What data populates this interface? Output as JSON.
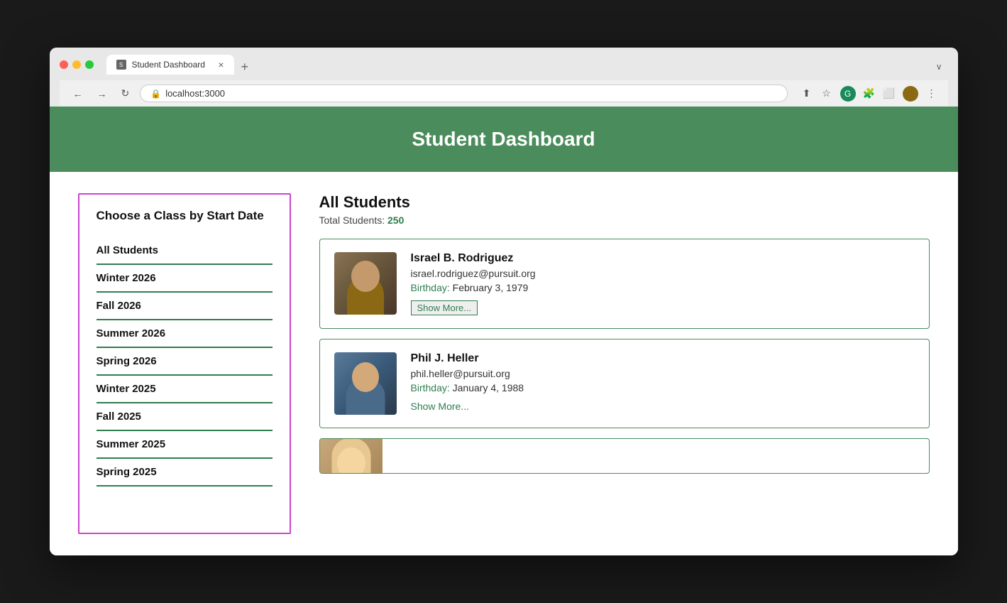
{
  "browser": {
    "tab_title": "Student Dashboard",
    "tab_close": "×",
    "tab_new": "+",
    "tab_dropdown": "∨",
    "url": "localhost:3000",
    "nav": {
      "back": "←",
      "forward": "→",
      "reload": "↻",
      "share": "⬆",
      "star": "☆",
      "menu": "⋮"
    }
  },
  "header": {
    "title": "Student Dashboard"
  },
  "sidebar": {
    "title": "Choose a Class by Start Date",
    "items": [
      {
        "label": "All Students"
      },
      {
        "label": "Winter 2026"
      },
      {
        "label": "Fall 2026"
      },
      {
        "label": "Summer 2026"
      },
      {
        "label": "Spring 2026"
      },
      {
        "label": "Winter 2025"
      },
      {
        "label": "Fall 2025"
      },
      {
        "label": "Summer 2025"
      },
      {
        "label": "Spring 2025"
      }
    ]
  },
  "main": {
    "section_title": "All Students",
    "total_label": "Total Students:",
    "total_count": "250",
    "students": [
      {
        "name": "Israel B. Rodriguez",
        "email": "israel.rodriguez@pursuit.org",
        "birthday_label": "Birthday:",
        "birthday": "February 3, 1979",
        "show_more": "Show More...",
        "avatar_type": "israel"
      },
      {
        "name": "Phil J. Heller",
        "email": "phil.heller@pursuit.org",
        "birthday_label": "Birthday:",
        "birthday": "January 4, 1988",
        "show_more": "Show More...",
        "avatar_type": "phil"
      },
      {
        "name": "",
        "email": "",
        "birthday_label": "",
        "birthday": "",
        "show_more": "",
        "avatar_type": "female"
      }
    ]
  },
  "colors": {
    "header_bg": "#4a8c5c",
    "sidebar_border": "#cc44cc",
    "green_accent": "#2e7d4f",
    "text_dark": "#111111"
  }
}
